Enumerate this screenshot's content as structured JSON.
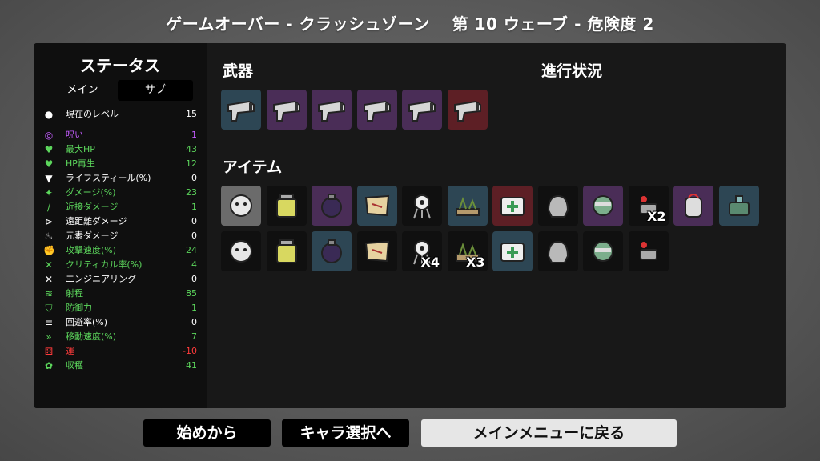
{
  "title": "ゲームオーバー - クラッシュゾーン　 第 10 ウェーブ - 危険度 2",
  "stats_panel": {
    "title": "ステータス",
    "tabs": [
      {
        "label": "メイン"
      },
      {
        "label": "サブ"
      }
    ],
    "rows": [
      {
        "icon": "level-icon",
        "label": "現在のレベル",
        "value": "15",
        "color": "#ffffff",
        "glyph": "●"
      },
      {
        "icon": "curse-icon",
        "label": "呪い",
        "value": "1",
        "color": "#c45cff",
        "glyph": "◎"
      },
      {
        "icon": "heart-icon",
        "label": "最大HP",
        "value": "43",
        "color": "#5cd65c",
        "glyph": "♥"
      },
      {
        "icon": "hp-regen-icon",
        "label": "HP再生",
        "value": "12",
        "color": "#5cd65c",
        "glyph": "♥"
      },
      {
        "icon": "lifesteal-icon",
        "label": "ライフスティール(%)",
        "value": "0",
        "color": "#ffffff",
        "glyph": "▼"
      },
      {
        "icon": "damage-icon",
        "label": "ダメージ(%)",
        "value": "23",
        "color": "#5cd65c",
        "glyph": "✦"
      },
      {
        "icon": "melee-icon",
        "label": "近接ダメージ",
        "value": "1",
        "color": "#5cd65c",
        "glyph": "/"
      },
      {
        "icon": "ranged-icon",
        "label": "遠距離ダメージ",
        "value": "0",
        "color": "#ffffff",
        "glyph": "⊳"
      },
      {
        "icon": "elemental-icon",
        "label": "元素ダメージ",
        "value": "0",
        "color": "#ffffff",
        "glyph": "♨"
      },
      {
        "icon": "attack-speed-icon",
        "label": "攻撃速度(%)",
        "value": "24",
        "color": "#5cd65c",
        "glyph": "✊"
      },
      {
        "icon": "crit-icon",
        "label": "クリティカル率(%)",
        "value": "4",
        "color": "#5cd65c",
        "glyph": "✕"
      },
      {
        "icon": "engineering-icon",
        "label": "エンジニアリング",
        "value": "0",
        "color": "#ffffff",
        "glyph": "✕"
      },
      {
        "icon": "range-icon",
        "label": "射程",
        "value": "85",
        "color": "#5cd65c",
        "glyph": "≋"
      },
      {
        "icon": "armor-icon",
        "label": "防御力",
        "value": "1",
        "color": "#5cd65c",
        "glyph": "⛉"
      },
      {
        "icon": "dodge-icon",
        "label": "回避率(%)",
        "value": "0",
        "color": "#ffffff",
        "glyph": "≡"
      },
      {
        "icon": "speed-icon",
        "label": "移動速度(%)",
        "value": "7",
        "color": "#5cd65c",
        "glyph": "»"
      },
      {
        "icon": "luck-icon",
        "label": "運",
        "value": "-10",
        "color": "#ff3b3b",
        "glyph": "⚄"
      },
      {
        "icon": "harvest-icon",
        "label": "収穫",
        "value": "41",
        "color": "#5cd65c",
        "glyph": "✿"
      }
    ]
  },
  "weapons": {
    "label": "武器",
    "list": [
      {
        "name": "megaphone-gun-icon",
        "tier": "blue"
      },
      {
        "name": "double-barrel-gun-icon",
        "tier": "purple"
      },
      {
        "name": "revolver-icon",
        "tier": "purple"
      },
      {
        "name": "smg-icon",
        "tier": "purple"
      },
      {
        "name": "smg-icon-2",
        "tier": "purple"
      },
      {
        "name": "red-pistol-icon",
        "tier": "red"
      }
    ]
  },
  "progress": {
    "label": "進行状況"
  },
  "items": {
    "label": "アイテム",
    "row1": [
      {
        "name": "snowman-hat-icon",
        "tier": "gray",
        "count": ""
      },
      {
        "name": "lemonade-icon",
        "tier": "dark",
        "count": ""
      },
      {
        "name": "bomb-bag-icon",
        "tier": "purple",
        "count": ""
      },
      {
        "name": "treasure-map-icon",
        "tier": "blue",
        "count": ""
      },
      {
        "name": "target-dummy-icon",
        "tier": "dark",
        "count": ""
      },
      {
        "name": "garden-icon",
        "tier": "blue",
        "count": ""
      },
      {
        "name": "medkit-icon",
        "tier": "red",
        "count": ""
      },
      {
        "name": "helmet-icon",
        "tier": "dark",
        "count": ""
      },
      {
        "name": "zombie-head-icon",
        "tier": "purple",
        "count": ""
      },
      {
        "name": "turret-icon",
        "tier": "dark",
        "count": "X2"
      },
      {
        "name": "jar-icon",
        "tier": "purple",
        "count": ""
      },
      {
        "name": "robot-icon",
        "tier": "blue",
        "count": ""
      }
    ],
    "row2": [
      {
        "name": "lizard-icon",
        "tier": "dark",
        "count": ""
      },
      {
        "name": "tree-icon",
        "tier": "dark",
        "count": ""
      },
      {
        "name": "stone-circle-icon",
        "tier": "blue",
        "count": ""
      },
      {
        "name": "cat-icon",
        "tier": "dark",
        "count": ""
      },
      {
        "name": "rocket-icon",
        "tier": "dark",
        "count": "X4"
      },
      {
        "name": "bill-icon",
        "tier": "dark",
        "count": "X3"
      },
      {
        "name": "sauce-bottle-icon",
        "tier": "blue",
        "count": ""
      },
      {
        "name": "coffee-cup-icon",
        "tier": "dark",
        "count": ""
      },
      {
        "name": "boxing-glove-icon",
        "tier": "dark",
        "count": ""
      },
      {
        "name": "pencil-icon",
        "tier": "dark",
        "count": ""
      }
    ]
  },
  "buttons": {
    "restart": "始めから",
    "character_select": "キャラ選択へ",
    "main_menu": "メインメニューに戻る"
  }
}
